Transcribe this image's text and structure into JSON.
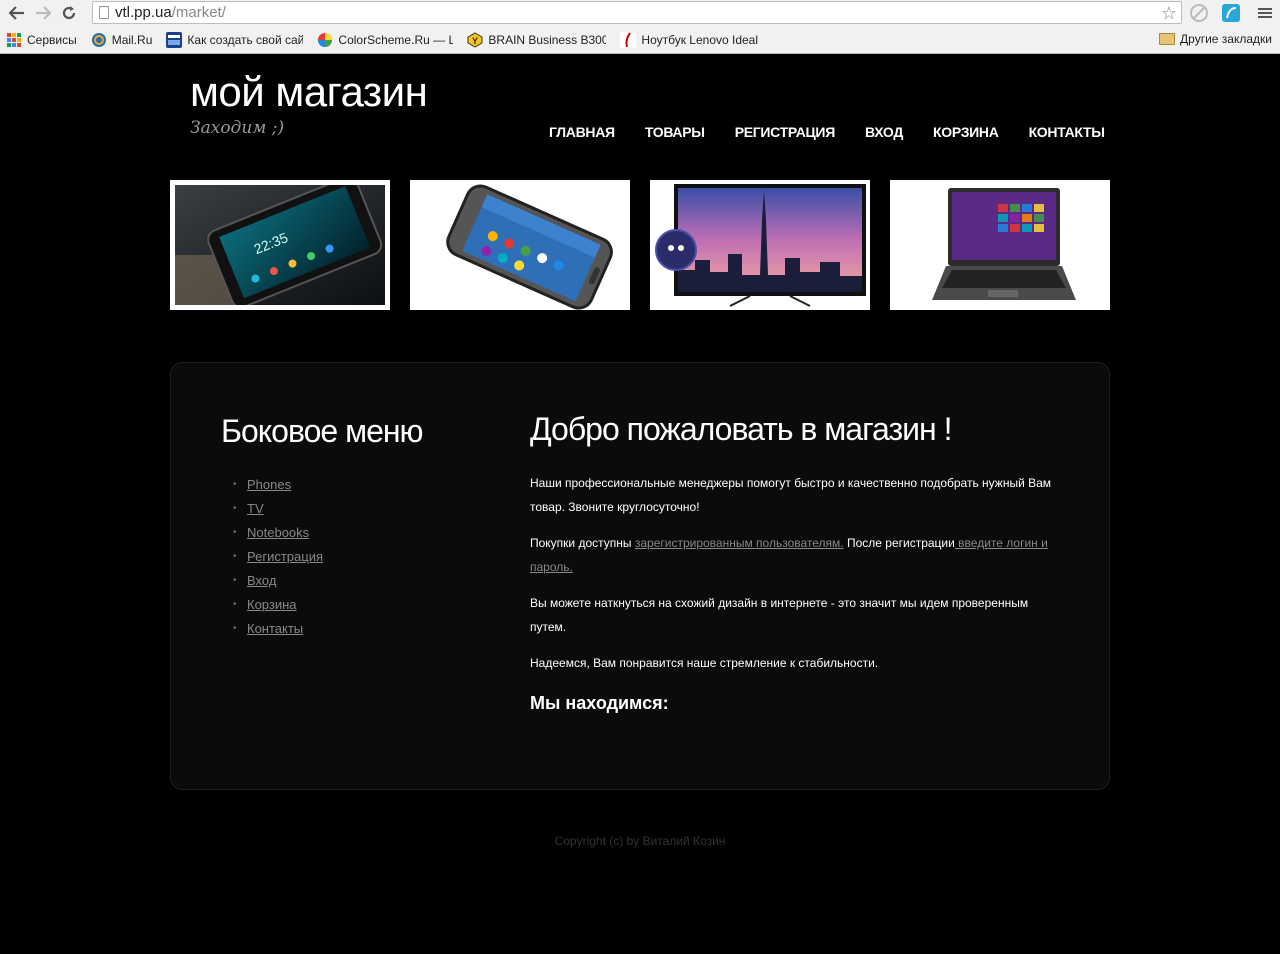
{
  "browser": {
    "url_host": "vtl.pp.ua",
    "url_path": "/market/",
    "bookmarks": [
      {
        "label": "Сервисы",
        "icon": "apps-grid-icon"
      },
      {
        "label": "Mail.Ru",
        "icon": "mailru-icon"
      },
      {
        "label": "Как создать свой сай",
        "icon": "site-icon"
      },
      {
        "label": "ColorScheme.Ru — Li",
        "icon": "colorscheme-icon"
      },
      {
        "label": "BRAIN Business B300",
        "icon": "brain-icon"
      },
      {
        "label": "Ноутбук Lenovo Ideal",
        "icon": "lenovo-icon"
      }
    ],
    "other_bookmarks": "Другие закладки"
  },
  "site": {
    "logo": "мой магазин",
    "slogan": "Заходим ;)",
    "menu": [
      "ГЛАВНАЯ",
      "ТОВАРЫ",
      "РЕГИСТРАЦИЯ",
      "ВХОД",
      "КОРЗИНА",
      "КОНТАКТЫ"
    ]
  },
  "sidebar": {
    "title": "Боковое меню",
    "items": [
      "Phones",
      "TV",
      "Notebooks",
      "Регистрация",
      "Вход",
      "Корзина",
      "Контакты"
    ]
  },
  "main": {
    "title": "Добро пожаловать в магазин !",
    "p1": "Наши профессиональные менеджеры помогут быстро и качественно подобрать нужный Вам товар. Звоните круглосуточно!",
    "p2_before": "Покупки доступны ",
    "p2_link1": "зарегистрированным пользователям.",
    "p2_middle": " После регистрации",
    "p2_link2": " введите логин и пароль.",
    "p3": "Вы можете наткнуться на схожий дизайн в интернете - это значит мы идем проверенным путем.",
    "p4": "Надеемся, Вам понравится наше стремление к стабильности.",
    "located": "Мы находимся:"
  },
  "footer": "Copyright (c) by Виталий Козин",
  "colors": {
    "background": "#000000",
    "panel": "#0b0b0b",
    "link": "#888888"
  }
}
